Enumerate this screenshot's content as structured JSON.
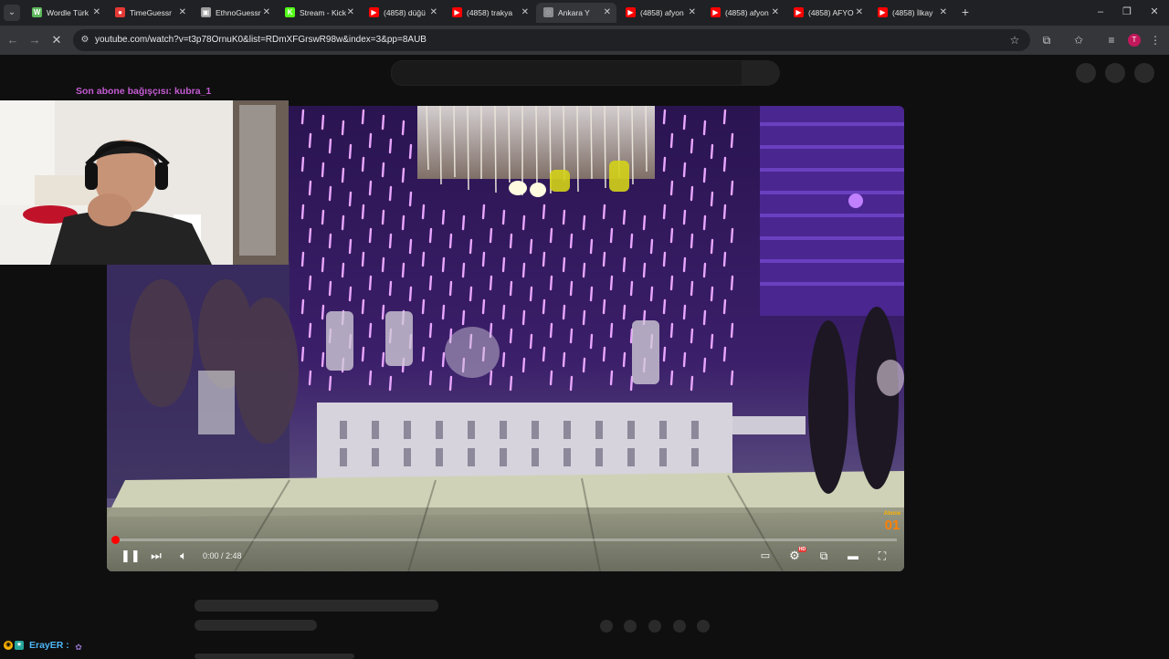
{
  "browser": {
    "tabs": [
      {
        "title": "Wordle Türk",
        "favicon": "wordle-w-icon",
        "fav_char": "W",
        "fav_color": "#5cb85c",
        "active": false
      },
      {
        "title": "TimeGuessr",
        "favicon": "timeguessr-icon",
        "fav_char": "●",
        "fav_color": "#e53935",
        "active": false
      },
      {
        "title": "EthnoGuessr",
        "favicon": "ethnoguessr-icon",
        "fav_char": "▣",
        "fav_color": "#9e9e9e",
        "active": false
      },
      {
        "title": "Stream - Kick",
        "favicon": "kick-icon",
        "fav_char": "K",
        "fav_color": "#53fc18",
        "active": false
      },
      {
        "title": "(4858) düğü",
        "favicon": "youtube-icon",
        "fav_char": "▶",
        "fav_color": "#ff0000",
        "active": false
      },
      {
        "title": "(4858) trakya",
        "favicon": "youtube-icon",
        "fav_char": "▶",
        "fav_color": "#ff0000",
        "active": false
      },
      {
        "title": "Ankara Y",
        "favicon": "loading-icon",
        "fav_char": "◌",
        "fav_color": "#8a8c90",
        "active": true
      },
      {
        "title": "(4858) afyon",
        "favicon": "youtube-icon",
        "fav_char": "▶",
        "fav_color": "#ff0000",
        "active": false
      },
      {
        "title": "(4858) afyon",
        "favicon": "youtube-icon",
        "fav_char": "▶",
        "fav_color": "#ff0000",
        "active": false
      },
      {
        "title": "(4858) AFYO",
        "favicon": "youtube-icon",
        "fav_char": "▶",
        "fav_color": "#ff0000",
        "active": false
      },
      {
        "title": "(4858) İlkay",
        "favicon": "youtube-icon",
        "fav_char": "▶",
        "fav_color": "#ff0000",
        "active": false
      }
    ],
    "url": "youtube.com/watch?v=t3p78OrnuK0&list=RDmXFGrswR98w&index=3&pp=8AUB",
    "profile_initial": "T"
  },
  "overlay": {
    "donor_text": "Son abone bağışçısı: kubra_1",
    "chat_user": "ErayER :"
  },
  "player": {
    "time": "0:00 / 2:48",
    "progress": 0.0,
    "hd_badge": "HD",
    "watermark_top": "Abone",
    "watermark_num": "01"
  }
}
